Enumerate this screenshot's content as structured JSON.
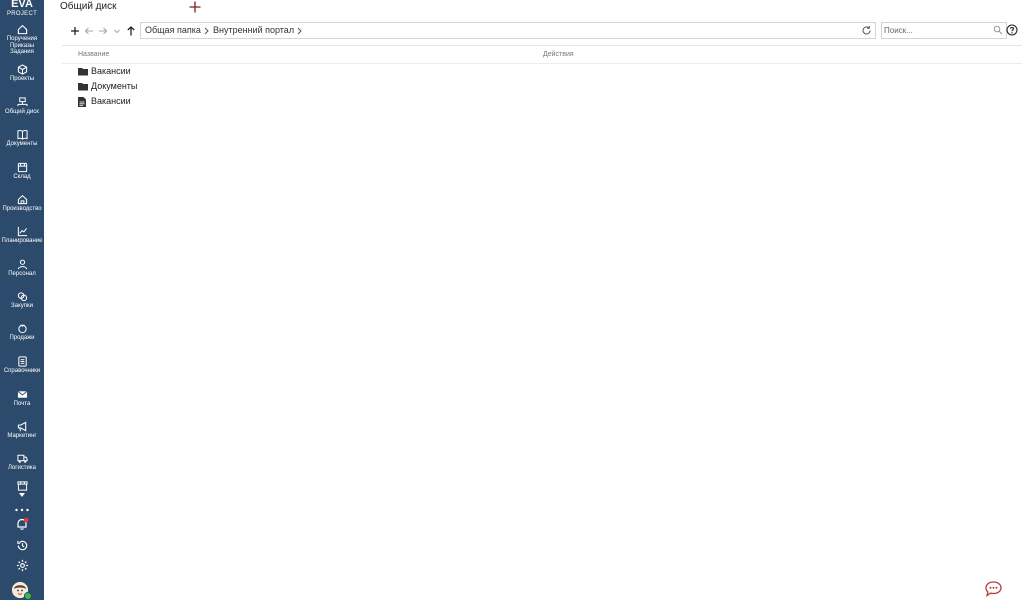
{
  "app": {
    "logo_main": "EVA",
    "logo_sub": "PROJECT"
  },
  "sidebar": {
    "items": [
      {
        "label": "Поручения\nПриказы\nЗадания",
        "icon": "house-icon"
      },
      {
        "label": "Проекты",
        "icon": "cube-icon"
      },
      {
        "label": "Общий диск",
        "icon": "network-drive-icon"
      },
      {
        "label": "Документы",
        "icon": "book-icon"
      },
      {
        "label": "Склад",
        "icon": "warehouse-icon"
      },
      {
        "label": "Производство",
        "icon": "factory-icon"
      },
      {
        "label": "Планирование",
        "icon": "chart-icon"
      },
      {
        "label": "Персонал",
        "icon": "person-icon"
      },
      {
        "label": "Закупки",
        "icon": "coins-icon"
      },
      {
        "label": "Продажи",
        "icon": "sales-icon"
      },
      {
        "label": "Справочники",
        "icon": "directory-icon"
      },
      {
        "label": "Почта",
        "icon": "mail-icon"
      },
      {
        "label": "Маркетинг",
        "icon": "megaphone-icon"
      },
      {
        "label": "Логистика",
        "icon": "truck-icon"
      }
    ]
  },
  "header": {
    "title": "Общий диск"
  },
  "toolbar": {
    "breadcrumbs": [
      "Общая папка",
      "Внутренний портал"
    ],
    "search_placeholder": "Поиск..."
  },
  "table": {
    "columns": [
      "Название",
      "Действия"
    ],
    "rows": [
      {
        "name": "Вакансии",
        "type": "folder"
      },
      {
        "name": "Документы",
        "type": "folder"
      },
      {
        "name": "Вакансии",
        "type": "file"
      }
    ]
  },
  "colors": {
    "sidebar_bg": "#2c4a6b",
    "notification": "#e53935",
    "online": "#3db84a",
    "accent": "#b23c3c"
  }
}
